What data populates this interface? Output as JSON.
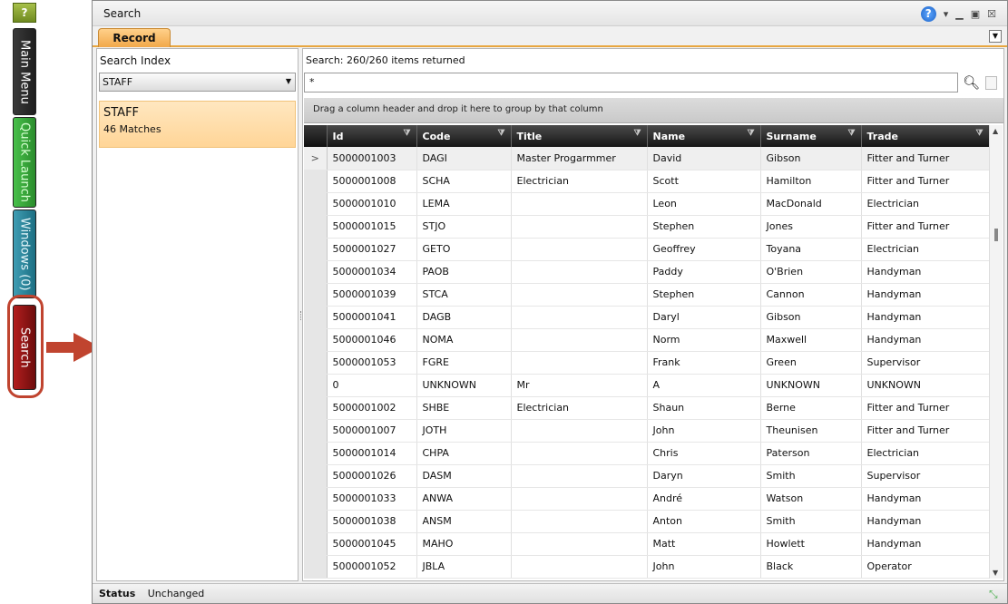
{
  "launcher": {
    "help": "?",
    "main_menu": "Main Menu",
    "quick_launch": "Quick Launch",
    "windows": "Windows (0)",
    "search": "Search"
  },
  "window": {
    "title": "Search"
  },
  "tabs": {
    "record": "Record"
  },
  "left_panel": {
    "header": "Search Index",
    "index_value": "STAFF",
    "match_title": "STAFF",
    "match_count": "46 Matches"
  },
  "right_panel": {
    "results_label": "Search: 260/260 items returned",
    "search_value": "*",
    "group_hint": "Drag a column header and drop it here to group by that column"
  },
  "table": {
    "columns": [
      "Id",
      "Code",
      "Title",
      "Name",
      "Surname",
      "Trade"
    ],
    "rows": [
      [
        "5000001003",
        "DAGI",
        "Master Progarmmer",
        "David",
        "Gibson",
        "Fitter and Turner"
      ],
      [
        "5000001008",
        "SCHA",
        "Electrician",
        "Scott",
        "Hamilton",
        "Fitter and Turner"
      ],
      [
        "5000001010",
        "LEMA",
        "",
        "Leon",
        "MacDonald",
        "Electrician"
      ],
      [
        "5000001015",
        "STJO",
        "",
        "Stephen",
        "Jones",
        "Fitter and Turner"
      ],
      [
        "5000001027",
        "GETO",
        "",
        "Geoffrey",
        "Toyana",
        "Electrician"
      ],
      [
        "5000001034",
        "PAOB",
        "",
        "Paddy",
        "O'Brien",
        "Handyman"
      ],
      [
        "5000001039",
        "STCA",
        "",
        "Stephen",
        "Cannon",
        "Handyman"
      ],
      [
        "5000001041",
        "DAGB",
        "",
        "Daryl",
        "Gibson",
        "Handyman"
      ],
      [
        "5000001046",
        "NOMA",
        "",
        "Norm",
        "Maxwell",
        "Handyman"
      ],
      [
        "5000001053",
        "FGRE",
        "",
        "Frank",
        "Green",
        "Supervisor"
      ],
      [
        "0",
        "UNKNOWN",
        "Mr",
        "A",
        "UNKNOWN",
        "UNKNOWN"
      ],
      [
        "5000001002",
        "SHBE",
        "Electrician",
        "Shaun",
        "Berne",
        "Fitter and Turner"
      ],
      [
        "5000001007",
        "JOTH",
        "",
        "John",
        "Theunisen",
        "Fitter and Turner"
      ],
      [
        "5000001014",
        "CHPA",
        "",
        "Chris",
        "Paterson",
        "Electrician"
      ],
      [
        "5000001026",
        "DASM",
        "",
        "Daryn",
        "Smith",
        "Supervisor"
      ],
      [
        "5000001033",
        "ANWA",
        "",
        "André",
        "Watson",
        "Handyman"
      ],
      [
        "5000001038",
        "ANSM",
        "",
        "Anton",
        "Smith",
        "Handyman"
      ],
      [
        "5000001045",
        "MAHO",
        "",
        "Matt",
        "Howlett",
        "Handyman"
      ],
      [
        "5000001052",
        "JBLA",
        "",
        "John",
        "Black",
        "Operator"
      ]
    ]
  },
  "status": {
    "label": "Status",
    "value": "Unchanged"
  },
  "colors": {
    "accent": "#f1a84a",
    "search_tab": "#8f1414",
    "annotation": "#c0442f"
  }
}
